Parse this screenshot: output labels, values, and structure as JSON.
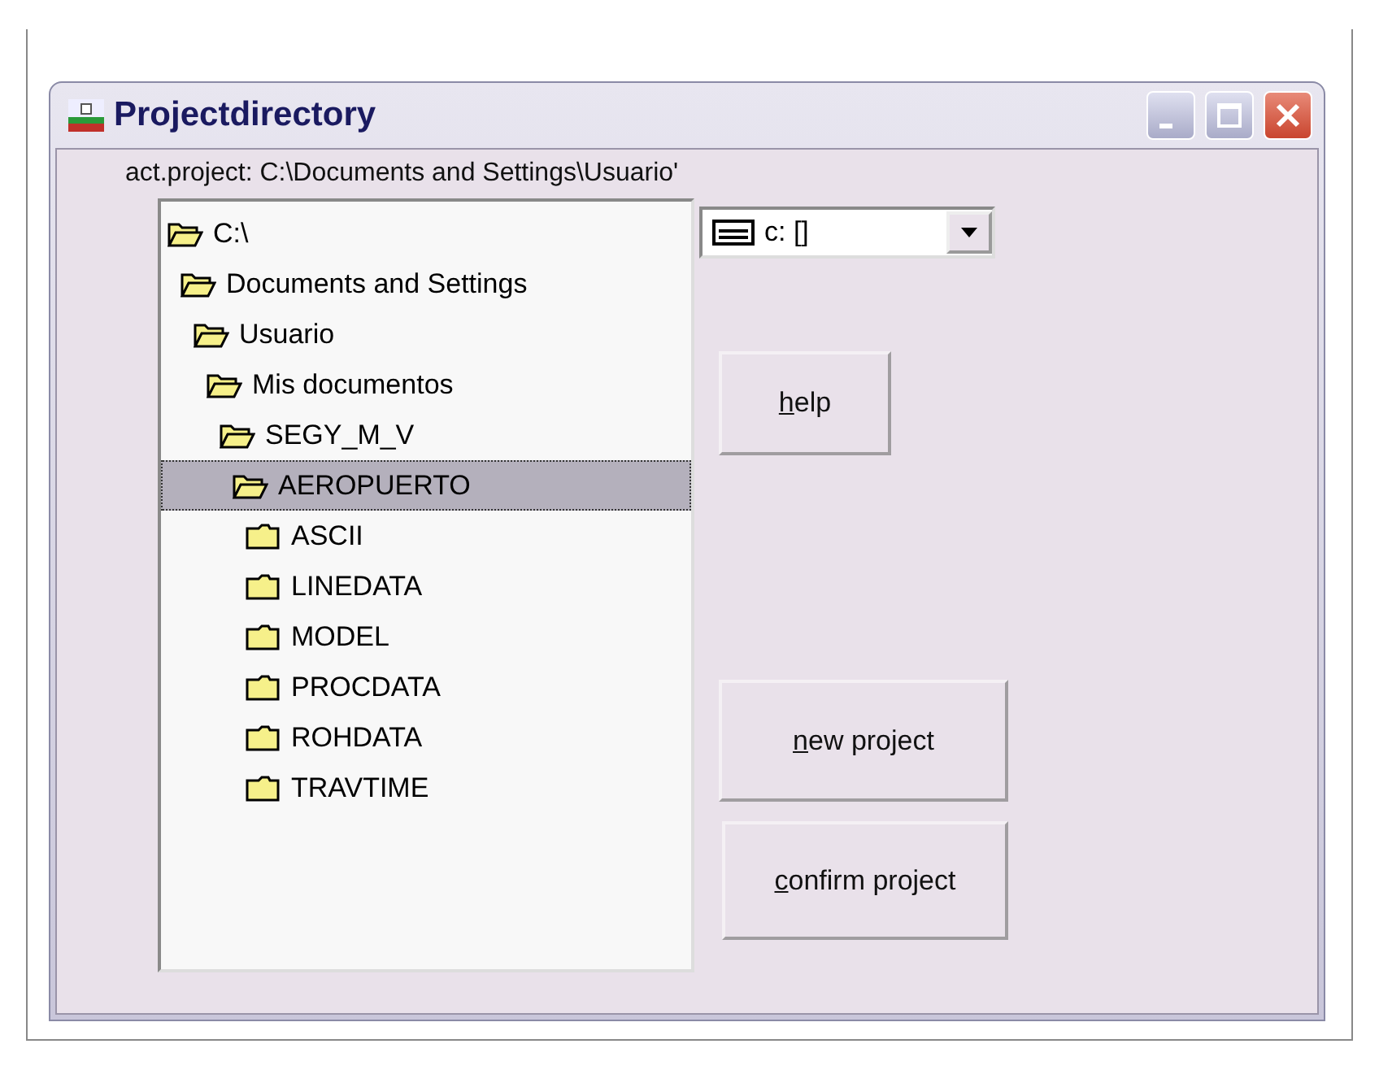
{
  "window": {
    "title": "Projectdirectory"
  },
  "current_project_label": "act.project: C:\\Documents and Settings\\Usuario'",
  "tree": [
    {
      "label": "C:\\",
      "expanded": true,
      "selected": false,
      "children": [
        {
          "label": "Documents and Settings",
          "expanded": true,
          "selected": false,
          "children": [
            {
              "label": "Usuario",
              "expanded": true,
              "selected": false,
              "children": [
                {
                  "label": "Mis documentos",
                  "expanded": true,
                  "selected": false,
                  "children": [
                    {
                      "label": "SEGY_M_V",
                      "expanded": true,
                      "selected": false,
                      "children": [
                        {
                          "label": "AEROPUERTO",
                          "expanded": true,
                          "selected": true,
                          "children": [
                            {
                              "label": "ASCII",
                              "expanded": false,
                              "selected": false
                            },
                            {
                              "label": "LINEDATA",
                              "expanded": false,
                              "selected": false
                            },
                            {
                              "label": "MODEL",
                              "expanded": false,
                              "selected": false
                            },
                            {
                              "label": "PROCDATA",
                              "expanded": false,
                              "selected": false
                            },
                            {
                              "label": "ROHDATA",
                              "expanded": false,
                              "selected": false
                            },
                            {
                              "label": "TRAVTIME",
                              "expanded": false,
                              "selected": false
                            }
                          ]
                        }
                      ]
                    }
                  ]
                }
              ]
            }
          ]
        }
      ]
    }
  ],
  "drive_select": {
    "value": "c: []"
  },
  "buttons": [
    {
      "kind": "help",
      "label": "help"
    },
    {
      "kind": "new",
      "label": "new project"
    },
    {
      "kind": "confirm",
      "label": "confirm project"
    }
  ]
}
